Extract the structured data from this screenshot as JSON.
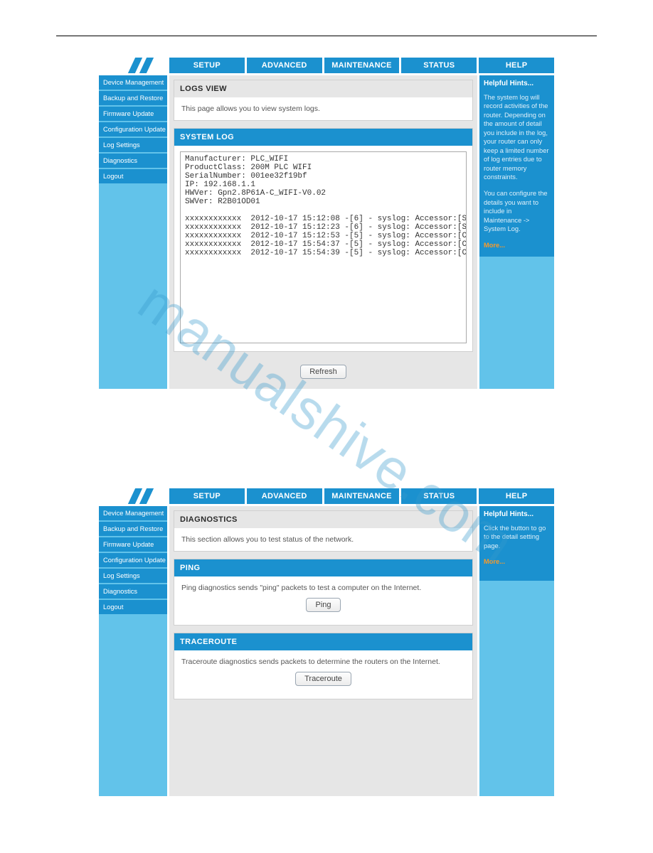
{
  "watermark": "manualshive.com",
  "nav": {
    "tabs": [
      "SETUP",
      "ADVANCED",
      "MAINTENANCE",
      "STATUS",
      "HELP"
    ]
  },
  "sidebar": {
    "items": [
      "Device Management",
      "Backup and Restore",
      "Firmware Update",
      "Configuration Update",
      "Log Settings",
      "Diagnostics",
      "Logout"
    ]
  },
  "screen1": {
    "logs_view_title": "LOGS VIEW",
    "logs_view_desc": "This page allows you to view system logs.",
    "system_log_title": "SYSTEM LOG",
    "log_text": "Manufacturer: PLC_WIFI\nProductClass: 200M PLC WIFI\nSerialNumber: 001ee32f19bf\nIP: 192.168.1.1\nHWVer: Gpn2.8P61A-C_WIFI-V0.02\nSWVer: R2B01OD01\n\nxxxxxxxxxxxx  2012-10-17 15:12:08 -[6] - syslog: Accessor:[Subscriber] Method:[CfgBkp] Para:[] Result:[00000000]\nxxxxxxxxxxxx  2012-10-17 15:12:23 -[6] - syslog: Accessor:[Subscriber] Method:[CfgBkp] Para:[] Result:[00000000]\nxxxxxxxxxxxx  2012-10-17 15:12:53 -[5] - syslog: Accessor:[CPE] Method:[AUTH] Para:[] Result:[] User admin login success\nxxxxxxxxxxxx  2012-10-17 15:54:37 -[5] - syslog: Accessor:[CPE] Method:[AUTH] Para:[] Result:[] User admin session timeout and auto logout\nxxxxxxxxxxxx  2012-10-17 15:54:39 -[5] - syslog: Accessor:[CPE] Method:[AUTH] Para:[] Result:[] User admin login success",
    "refresh_label": "Refresh",
    "hints_title": "Helpful Hints...",
    "hints_p1": "The system log will record activities of the router. Depending on the amount of detail you include in the log, your router can only keep a limited number of log entries due to router memory constraints.",
    "hints_p2": "You can configure the details you want to include in Maintenance -> System Log.",
    "more": "More..."
  },
  "screen2": {
    "diag_title": "DIAGNOSTICS",
    "diag_desc": "This section allows you to test status of the network.",
    "ping_title": "PING",
    "ping_desc": "Ping diagnostics sends \"ping\" packets to test a computer on the Internet.",
    "ping_btn": "Ping",
    "tr_title": "TRACEROUTE",
    "tr_desc": "Traceroute diagnostics sends packets to determine the routers on the Internet.",
    "tr_btn": "Traceroute",
    "hints_title": "Helpful Hints...",
    "hints_p1": "Click the button to go to the detail setting page.",
    "more": "More..."
  }
}
